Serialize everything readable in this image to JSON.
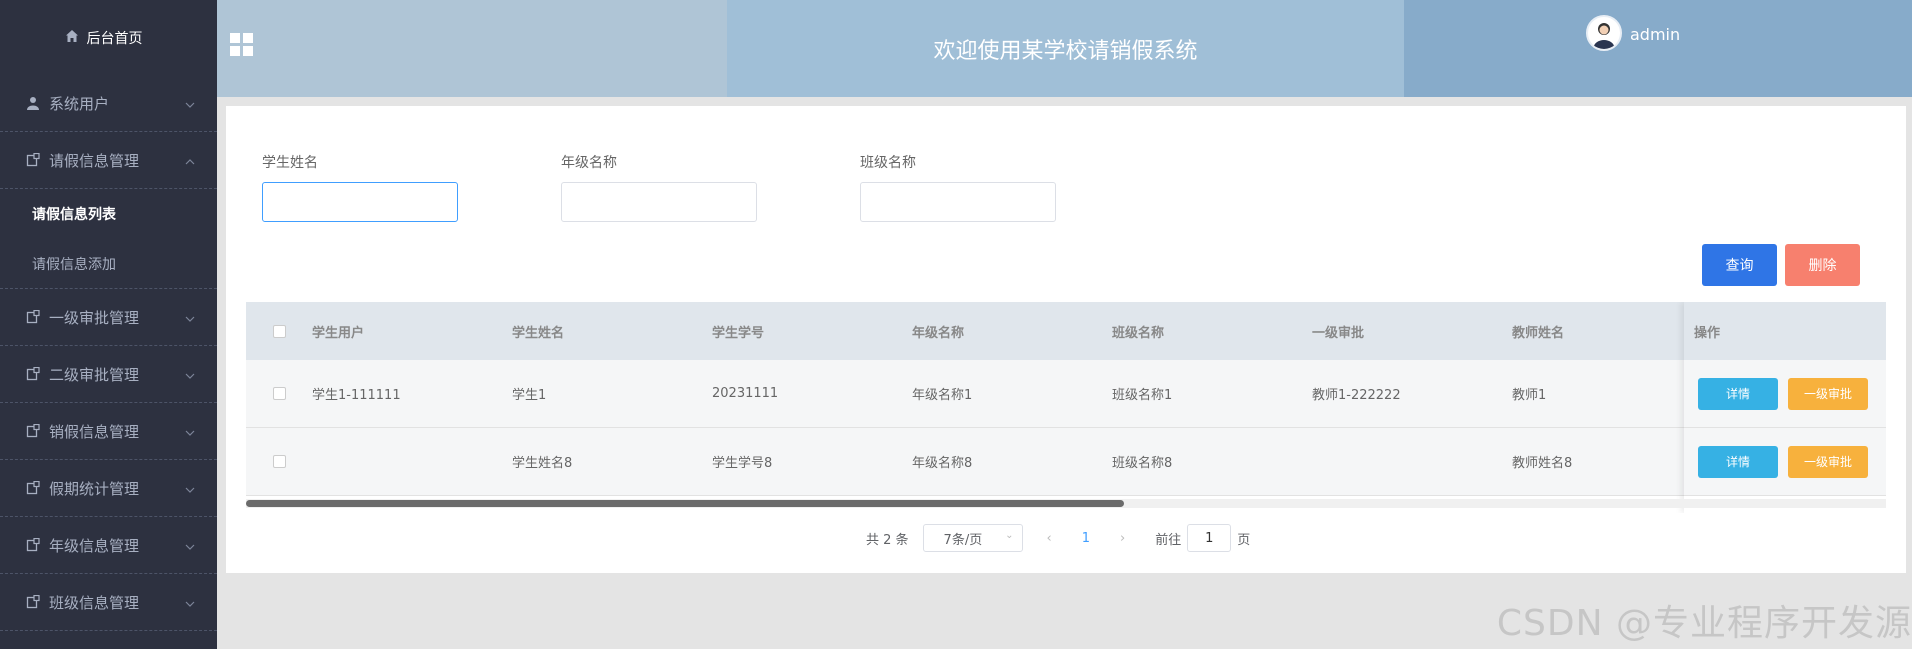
{
  "sidebar": {
    "home": "后台首页",
    "items": [
      {
        "label": "系统用户",
        "icon": "user-icon"
      },
      {
        "label": "请假信息管理",
        "icon": "doc-icon",
        "expanded": true,
        "children": [
          {
            "label": "请假信息列表",
            "active": true
          },
          {
            "label": "请假信息添加",
            "active": false
          }
        ]
      },
      {
        "label": "一级审批管理",
        "icon": "doc-icon"
      },
      {
        "label": "二级审批管理",
        "icon": "doc-icon"
      },
      {
        "label": "销假信息管理",
        "icon": "doc-icon"
      },
      {
        "label": "假期统计管理",
        "icon": "doc-icon"
      },
      {
        "label": "年级信息管理",
        "icon": "doc-icon"
      },
      {
        "label": "班级信息管理",
        "icon": "doc-icon"
      }
    ]
  },
  "header": {
    "title": "欢迎使用某学校请销假系统",
    "user": "admin"
  },
  "filters": {
    "student_name_label": "学生姓名",
    "student_name_value": "",
    "grade_name_label": "年级名称",
    "grade_name_value": "",
    "class_name_label": "班级名称",
    "class_name_value": ""
  },
  "actions": {
    "query": "查询",
    "delete": "删除"
  },
  "table": {
    "columns": [
      "学生用户",
      "学生姓名",
      "学生学号",
      "年级名称",
      "班级名称",
      "一级审批",
      "教师姓名"
    ],
    "op_header": "操作",
    "rows": [
      [
        "学生1-111111",
        "学生1",
        "20231111",
        "年级名称1",
        "班级名称1",
        "教师1-222222",
        "教师1"
      ],
      [
        "",
        "学生姓名8",
        "学生学号8",
        "年级名称8",
        "班级名称8",
        "",
        "教师姓名8"
      ]
    ],
    "detail_label": "详情",
    "approve_label": "一级审批"
  },
  "pagination": {
    "total": "共 2 条",
    "page_size": "7条/页",
    "current": "1",
    "goto_prefix": "前往",
    "goto_value": "1",
    "goto_suffix": "页"
  },
  "watermark": "CSDN @专业程序开发源",
  "colors": {
    "primary": "#2f75e6",
    "danger": "#f7806e",
    "info": "#36b1e4",
    "warning": "#f7b13d",
    "sidebar": "#2d3140"
  }
}
